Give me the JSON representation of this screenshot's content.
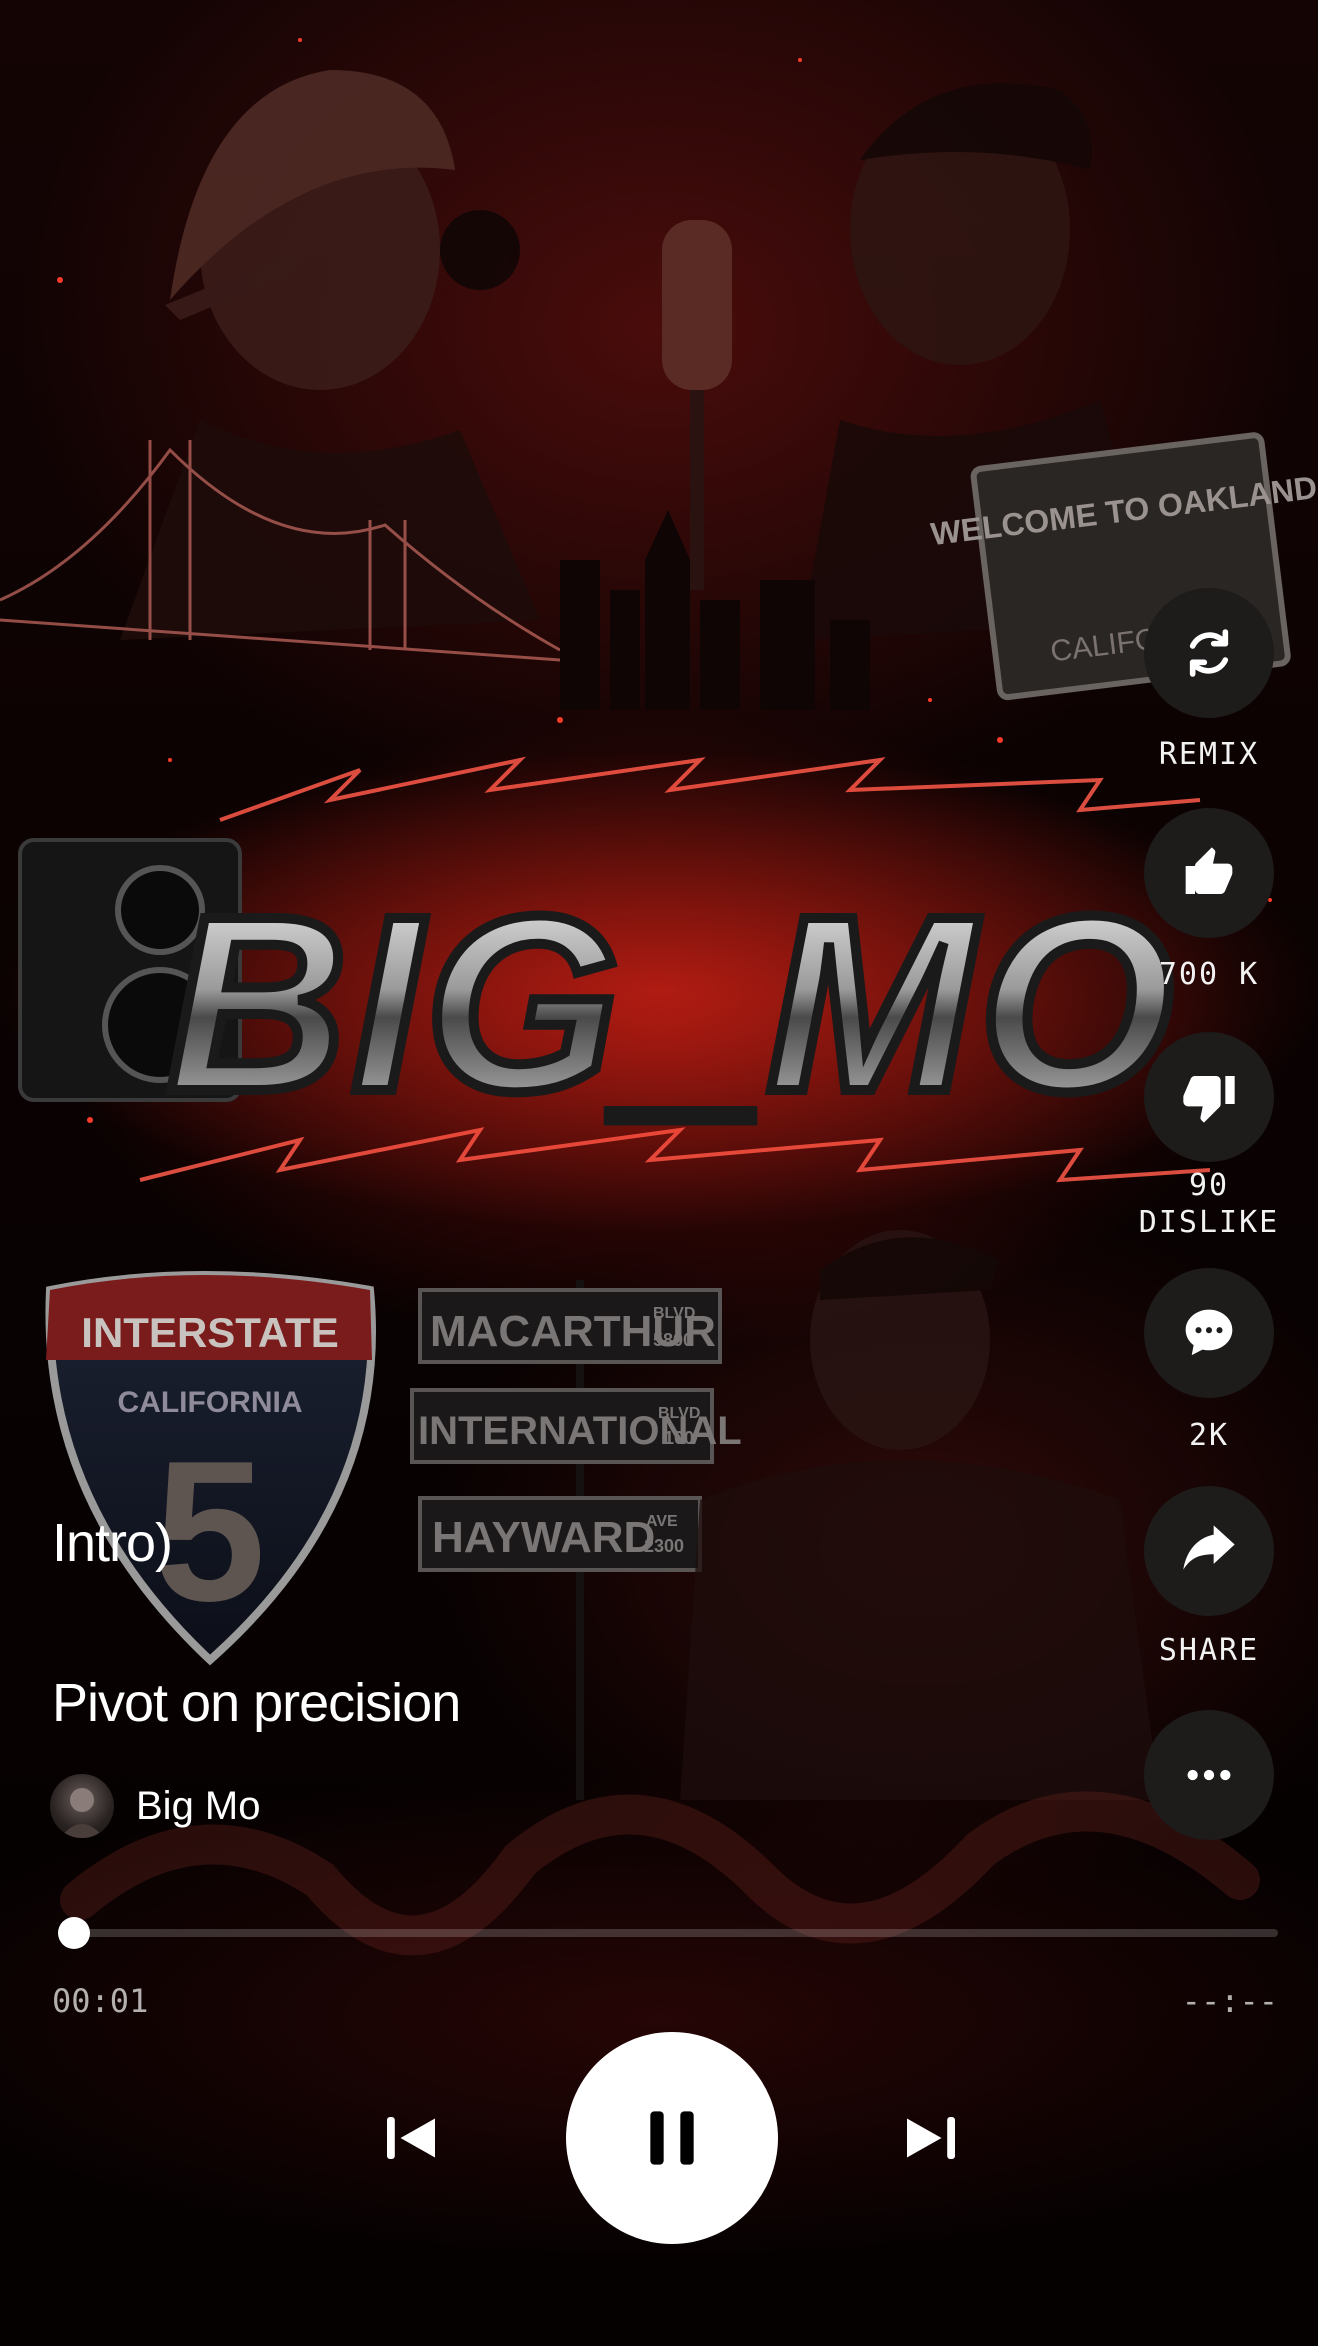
{
  "track": {
    "title": "Intro)",
    "subtitle": "Pivot on precision",
    "artist": "Big Mo"
  },
  "artwork": {
    "logo_text": "BIG_MO",
    "sign_welcome": "WELCOME TO OAKLAND",
    "sign_california": "CALIFORNIA",
    "shield_top": "INTERSTATE",
    "shield_state": "CALIFORNIA",
    "shield_number": "5",
    "street_signs": [
      {
        "name": "MACARTHUR",
        "suffix": "BLVD",
        "number": "5800"
      },
      {
        "name": "INTERNATIONAL",
        "suffix": "BLVD",
        "number": "100"
      },
      {
        "name": "HAYWARD",
        "suffix": "AVE",
        "number": "2300"
      }
    ]
  },
  "actions": {
    "remix_label": "REMIX",
    "like_count": "700 K",
    "dislike_count": "90",
    "dislike_label": "DISLIKE",
    "comment_count": "2K",
    "share_label": "SHARE"
  },
  "playback": {
    "elapsed": "00:01",
    "duration": "--:--",
    "progress": 0.01
  },
  "icons": {
    "remix": "remix-icon",
    "like": "thumbs-up-icon",
    "dislike": "thumbs-down-icon",
    "comment": "comment-icon",
    "share": "share-icon",
    "more": "more-icon",
    "previous": "skip-previous-icon",
    "pause": "pause-icon",
    "next": "skip-next-icon"
  },
  "colors": {
    "accent_red": "#c0141a",
    "rail_bg": "#1e1b1b",
    "muted_text": "#b4b0b0"
  }
}
